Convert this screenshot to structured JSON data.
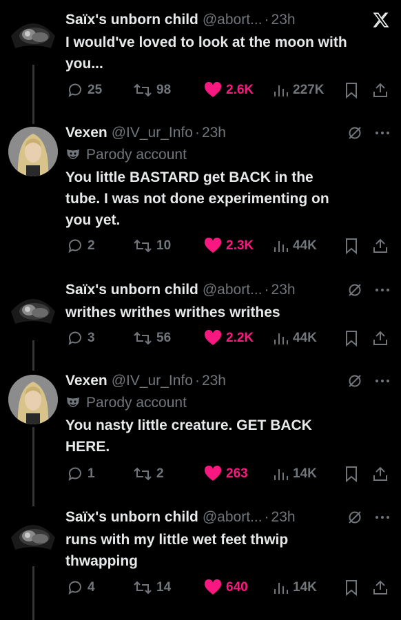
{
  "tweets": [
    {
      "name": "Saïx's unborn child",
      "handle": "@abort...",
      "time": "23h",
      "text": "I would've loved to look at the moon with you...",
      "text_lines": [
        "I would've loved to look at the moon with",
        "you..."
      ],
      "replies": "25",
      "reposts": "98",
      "likes": "2.6K",
      "views": "227K",
      "header_icon": "x-logo-icon",
      "avatar": "ultrasound-avatar"
    },
    {
      "name": "Vexen",
      "handle": "@IV_ur_Info",
      "time": "23h",
      "parody_label": "Parody account",
      "text": "You little BASTARD get BACK in the tube. I was not done experimenting on you yet.",
      "text_lines": [
        "You little BASTARD get BACK in the",
        "tube. I was not done experimenting on",
        "you yet."
      ],
      "replies": "2",
      "reposts": "10",
      "likes": "2.3K",
      "views": "44K",
      "header_icon": "grok-icon",
      "avatar": "vexen-avatar"
    },
    {
      "name": "Saïx's unborn child",
      "handle": "@abort...",
      "time": "23h",
      "text": "writhes writhes writhes writhes",
      "text_lines": [
        "writhes writhes writhes writhes"
      ],
      "replies": "3",
      "reposts": "56",
      "likes": "2.2K",
      "views": "44K",
      "header_icon": "grok-icon",
      "avatar": "ultrasound-avatar"
    },
    {
      "name": "Vexen",
      "handle": "@IV_ur_Info",
      "time": "23h",
      "parody_label": "Parody account",
      "text": "You nasty little creature. GET BACK HERE.",
      "text_lines": [
        "You nasty little creature. GET BACK",
        "HERE."
      ],
      "replies": "1",
      "reposts": "2",
      "likes": "263",
      "views": "14K",
      "header_icon": "grok-icon",
      "avatar": "vexen-avatar"
    },
    {
      "name": "Saïx's unborn child",
      "handle": "@abort...",
      "time": "23h",
      "text": "runs with my little wet feet thwip thwapping",
      "text_lines": [
        "runs with my little wet feet thwip",
        "thwapping"
      ],
      "replies": "4",
      "reposts": "14",
      "likes": "640",
      "views": "14K",
      "header_icon": "grok-icon",
      "avatar": "ultrasound-avatar"
    }
  ],
  "colors": {
    "background": "#000000",
    "text": "#e7e9ea",
    "muted": "#71767b",
    "like": "#f91880",
    "thread": "#333639"
  }
}
